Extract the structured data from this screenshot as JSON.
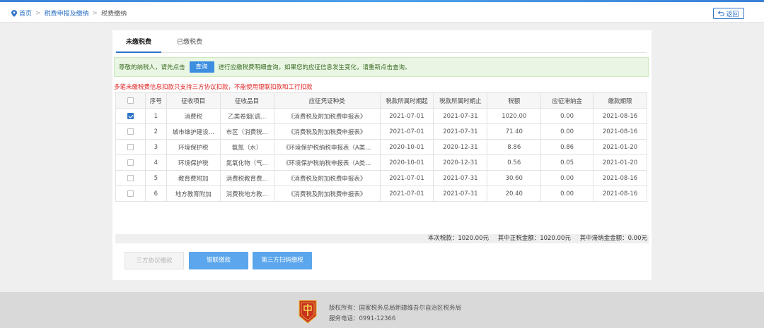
{
  "breadcrumb": {
    "home": "首页",
    "level2": "税费申报及缴纳",
    "current": "税费缴纳"
  },
  "back_label": "返回",
  "tabs": [
    {
      "label": "未缴税费",
      "active": true
    },
    {
      "label": "已缴税费",
      "active": false
    }
  ],
  "info": {
    "prefix": "尊敬的纳税人，请先点击",
    "query_button": "查询",
    "suffix": "进行应缴税费明细查询。如果您的应征信息发生变化，请重新点击查询。"
  },
  "warning": "多笔未缴税费信息扣款只支持三方协议扣款，不能使用银联扣款和工行扣款",
  "table": {
    "headers": [
      "",
      "序号",
      "征收项目",
      "征收品目",
      "应征凭证种类",
      "税款所属时期起",
      "税款所属时期止",
      "税额",
      "应征滞纳金",
      "缴款期限"
    ],
    "rows": [
      {
        "checked": true,
        "cells": [
          "1",
          "消费税",
          "乙类卷烟(调...",
          "《消费税及附加税费申报表》",
          "2021-07-01",
          "2021-07-31",
          "1020.00",
          "0.00",
          "2021-08-16"
        ]
      },
      {
        "checked": false,
        "cells": [
          "2",
          "城市维护建设...",
          "市区（消费税...",
          "《消费税及附加税费申报表》",
          "2021-07-01",
          "2021-07-31",
          "71.40",
          "0.00",
          "2021-08-16"
        ]
      },
      {
        "checked": false,
        "cells": [
          "3",
          "环境保护税",
          "氨氮（水）",
          "《环境保护税纳税申报表（A类...",
          "2020-10-01",
          "2020-12-31",
          "8.86",
          "0.86",
          "2021-01-20"
        ]
      },
      {
        "checked": false,
        "cells": [
          "4",
          "环境保护税",
          "氮氧化物（气...",
          "《环境保护税纳税申报表（A类...",
          "2020-10-01",
          "2020-12-31",
          "0.56",
          "0.05",
          "2021-01-20"
        ]
      },
      {
        "checked": false,
        "cells": [
          "5",
          "教育费附加",
          "消费税教育费...",
          "《消费税及附加税费申报表》",
          "2021-07-01",
          "2021-07-31",
          "30.60",
          "0.00",
          "2021-08-16"
        ]
      },
      {
        "checked": false,
        "cells": [
          "6",
          "地方教育附加",
          "消费税地方教...",
          "《消费税及附加税费申报表》",
          "2021-07-01",
          "2021-07-31",
          "20.40",
          "0.00",
          "2021-08-16"
        ]
      }
    ]
  },
  "summary": {
    "tax_due": "本次税款：1020.00元",
    "principal": "其中正税金额：1020.00元",
    "late_fee": "其中滞纳金金额：0.00元"
  },
  "buttons": {
    "agreement": "三方协议缴款",
    "unionpay": "银联缴款",
    "third_party_scan": "第三方扫码缴税"
  },
  "footer": {
    "copyright": "版权所有：国家税务总局新疆维吾尔自治区税务局",
    "phone": "服务电话：0991-12366"
  },
  "colors": {
    "accent": "#2f74c8",
    "warning": "#e02020",
    "info_bg": "#e9f6e3"
  }
}
